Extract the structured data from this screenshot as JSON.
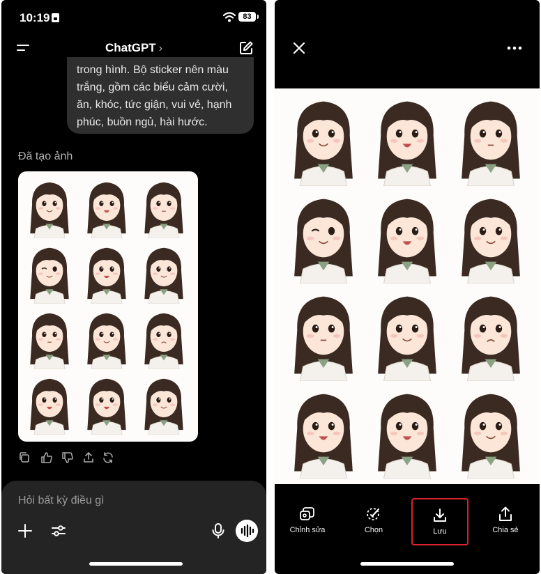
{
  "left": {
    "status": {
      "time": "10:19",
      "battery": "83"
    },
    "header": {
      "title": "ChatGPT",
      "chevron": "›"
    },
    "user_message": {
      "lines": [
        "trong hình. Bộ sticker nên màu",
        "trắng, gồm các biểu cảm cười,",
        "ăn, khóc, tức giận, vui vẻ, hạnh",
        "phúc, buồn ngủ, hài hước."
      ]
    },
    "generated_label": "Đã tạo ảnh",
    "message_actions": [
      "copy-icon",
      "thumbs-up-icon",
      "thumbs-down-icon",
      "share-icon",
      "regenerate-icon"
    ],
    "composer": {
      "placeholder": "Hỏi bất kỳ điều gì"
    }
  },
  "right": {
    "toolbar": [
      {
        "label": "Chỉnh sửa",
        "icon": "edit-image-icon"
      },
      {
        "label": "Chọn",
        "icon": "select-icon"
      },
      {
        "label": "Lưu",
        "icon": "download-icon",
        "highlighted": true
      },
      {
        "label": "Chia sẻ",
        "icon": "share-icon"
      }
    ]
  },
  "colors": {
    "background": "#000000",
    "bubble": "#2f2f2f",
    "composer": "#242424",
    "highlight": "#d8232a",
    "hair": "#3b2a22",
    "skin": "#fbe6d8"
  }
}
